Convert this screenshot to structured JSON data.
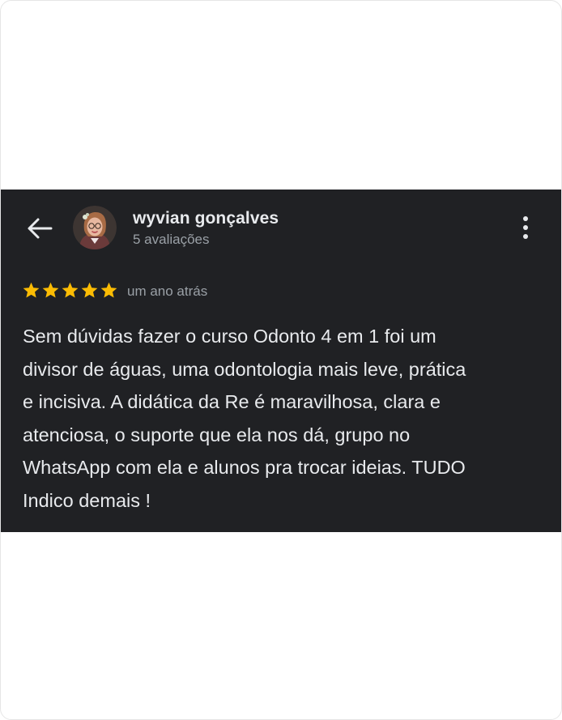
{
  "review": {
    "author_name": "wyvian gonçalves",
    "reviews_count": "5 avaliações",
    "rating": 5,
    "max_rating": 5,
    "time_ago": "um ano atrás",
    "text_lines": [
      "Sem dúvidas fazer o curso Odonto 4 em 1 foi um",
      "divisor de águas, uma odontologia mais leve, prática",
      "e incisiva. A didática da Re é maravilhosa, clara e",
      "atenciosa, o suporte que ela nos dá, grupo no",
      "WhatsApp com ela e alunos pra trocar ideias. TUDO",
      "Indico demais !"
    ]
  },
  "icons": {
    "back": "arrow-back-icon",
    "menu": "more-vert-icon",
    "star": "star-icon"
  },
  "colors": {
    "card_background": "#202124",
    "primary_text": "#e8eaed",
    "secondary_text": "#9aa0a6",
    "star": "#fbbc04"
  }
}
